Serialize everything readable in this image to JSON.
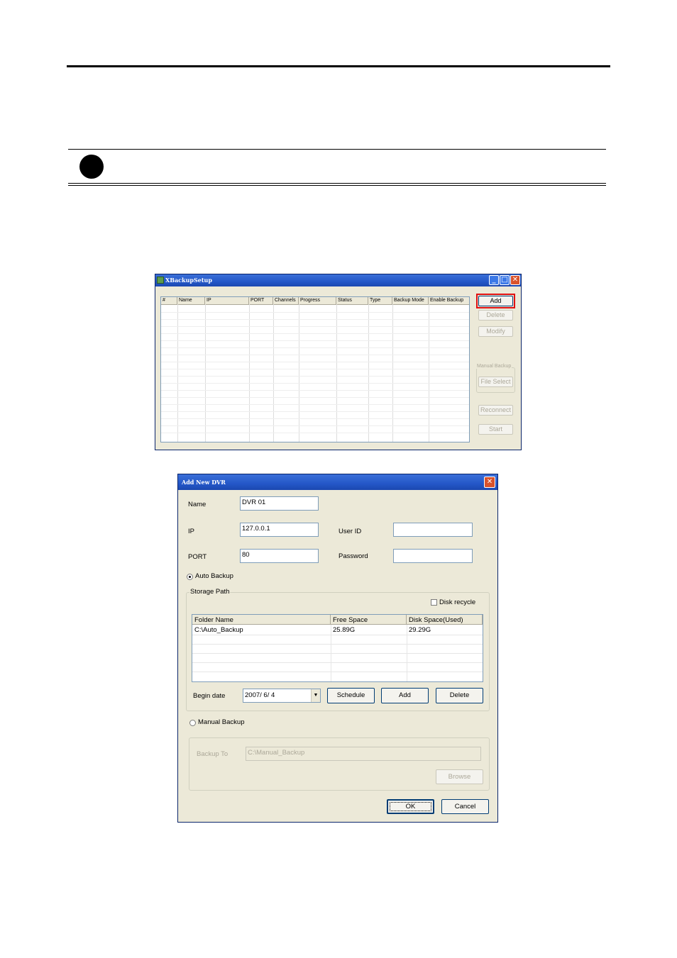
{
  "xbackup_window": {
    "title": "XBackupSetup",
    "columns": [
      "#",
      "Name",
      "IP",
      "PORT",
      "Channels",
      "Progress",
      "Status",
      "Type",
      "Backup Mode",
      "Enable Backup"
    ],
    "buttons": {
      "add": "Add",
      "delete": "Delete",
      "modify": "Modify",
      "file_select": "File Select",
      "reconnect": "Reconnect",
      "start": "Start"
    },
    "manual_backup_group": "Manual Backup",
    "title_buttons": {
      "minimize": "_",
      "maximize": "□",
      "close": "✕"
    }
  },
  "add_dvr_dialog": {
    "title": "Add New DVR",
    "close_glyph": "✕",
    "name_label": "Name",
    "name_value": "DVR 01",
    "ip_label": "IP",
    "ip_value": "127.0.0.1",
    "port_label": "PORT",
    "port_value": "80",
    "user_id_label": "User ID",
    "user_id_value": "",
    "password_label": "Password",
    "password_value": "",
    "auto_backup_label": "Auto Backup",
    "storage_path_label": "Storage Path",
    "disk_recycle_label": "Disk recycle",
    "storage_columns": [
      "Folder Name",
      "Free Space",
      "Disk Space(Used)"
    ],
    "storage_rows": [
      [
        "C:\\Auto_Backup",
        "25.89G",
        "29.29G"
      ]
    ],
    "begin_date_label": "Begin date",
    "begin_date_value": "2007/ 6/ 4",
    "schedule_button": "Schedule",
    "add_button": "Add",
    "delete_button": "Delete",
    "manual_backup_label": "Manual Backup",
    "backup_to_label": "Backup To",
    "backup_to_value": "C:\\Manual_Backup",
    "browse_button": "Browse",
    "ok_button": "OK",
    "cancel_button": "Cancel",
    "auto_backup_selected": true,
    "disk_recycle_checked": false
  }
}
